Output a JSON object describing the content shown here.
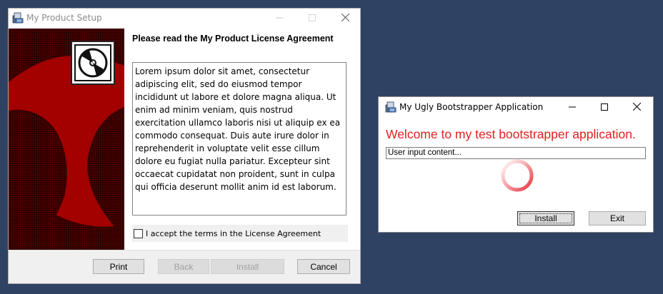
{
  "installer": {
    "title": "My Product Setup",
    "heading": "Please read the My Product License Agreement",
    "license_text": "Lorem ipsum dolor sit amet, consectetur adipiscing elit, sed do eiusmod tempor incididunt ut labore et dolore magna aliqua. Ut enim ad minim veniam, quis nostrud exercitation ullamco laboris nisi ut aliquip ex ea commodo consequat. Duis aute irure dolor in reprehenderit in voluptate velit esse cillum dolore eu fugiat nulla pariatur. Excepteur sint occaecat cupidatat non proident, sunt in culpa qui officia deserunt mollit anim id est laborum.",
    "accept_label": "I accept the terms in the License Agreement",
    "accept_checked": false,
    "buttons": {
      "print": "Print",
      "back": "Back",
      "install": "Install",
      "cancel": "Cancel"
    },
    "icons": [
      "installer-app-icon",
      "disc-logo-icon",
      "minimize-icon",
      "maximize-icon",
      "close-icon"
    ],
    "banner_color": "#a30000"
  },
  "bootstrapper": {
    "title": "My Ugly Bootstrapper Application",
    "welcome": "Welcome to my test bootstrapper application.",
    "input_value": "User input content...",
    "buttons": {
      "install": "Install",
      "exit": "Exit"
    },
    "welcome_color": "#e02020",
    "spinner_color": "#e8323c",
    "icons": [
      "installer-app-icon",
      "minimize-icon",
      "maximize-icon",
      "close-icon",
      "loading-spinner-icon"
    ]
  }
}
